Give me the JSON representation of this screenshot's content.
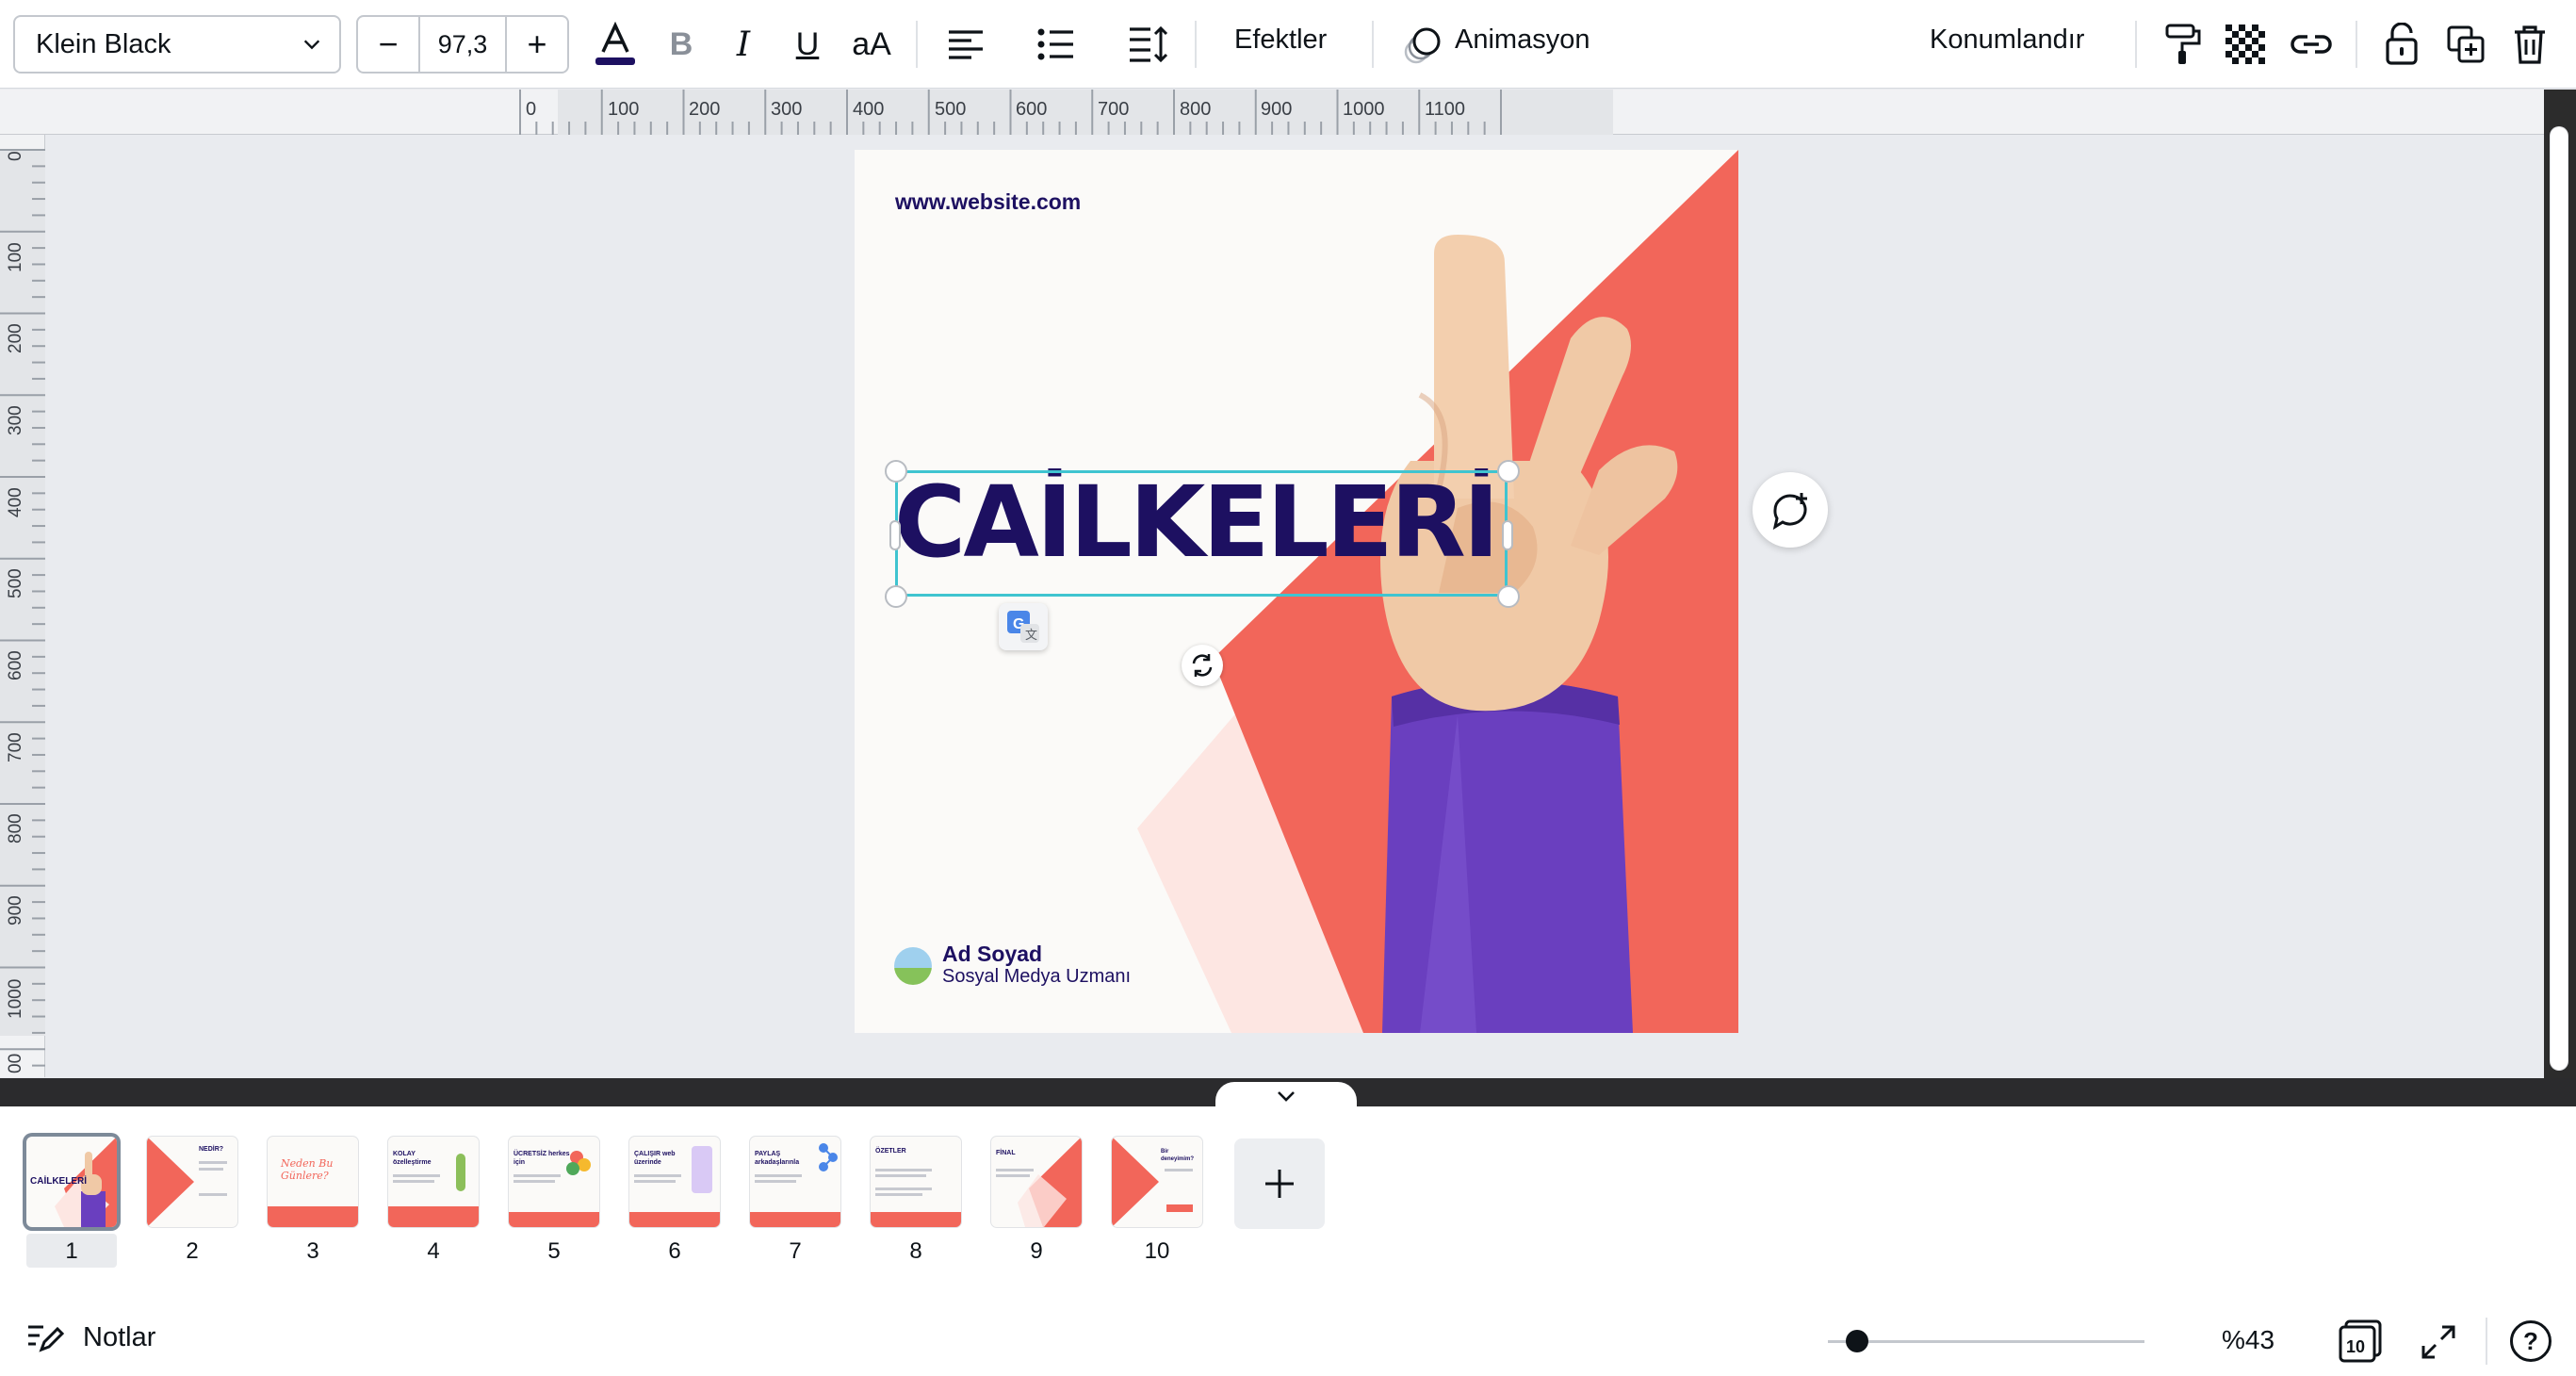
{
  "toolbar": {
    "font_family": "Klein Black",
    "font_size": "97,3",
    "minus_label": "−",
    "plus_label": "+",
    "case_label": "aA",
    "bold_label": "B",
    "italic_label": "I",
    "underline_label": "U",
    "text_color": "#1d1061",
    "effects_label": "Efektler",
    "animation_label": "Animasyon",
    "position_label": "Konumlandır"
  },
  "ruler": {
    "h_ticks": [
      "0",
      "100",
      "200",
      "300",
      "400",
      "500",
      "600",
      "700",
      "800",
      "900",
      "1000",
      "1100"
    ],
    "v_ticks": [
      "0",
      "100",
      "200",
      "300",
      "400",
      "500",
      "600",
      "700",
      "800",
      "900",
      "1000",
      "00"
    ]
  },
  "design": {
    "website": "www.website.com",
    "headline": "CAİLKELERİ",
    "author_name": "Ad Soyad",
    "author_title": "Sosyal Medya Uzmanı",
    "colors": {
      "navy": "#1d1061",
      "coral": "#f2665a",
      "pale_coral": "#fde6e2",
      "purple": "#6a3fbf",
      "selection": "#3fc4d0"
    }
  },
  "pages": [
    {
      "num": "1",
      "title": "CAİLKELERİ"
    },
    {
      "num": "2",
      "title": "NEDİR?"
    },
    {
      "num": "3",
      "title": "Neden Bu Günlere?"
    },
    {
      "num": "4",
      "title": "KOLAY özelleştirme"
    },
    {
      "num": "5",
      "title": "ÜCRETSİZ herkes için"
    },
    {
      "num": "6",
      "title": "ÇALIŞIR web üzerinde"
    },
    {
      "num": "7",
      "title": "PAYLAŞ arkadaşlarınla"
    },
    {
      "num": "8",
      "title": "ÖZETLER"
    },
    {
      "num": "9",
      "title": "FİNAL"
    },
    {
      "num": "10",
      "title": "Bir deneyimim?"
    }
  ],
  "footer": {
    "notes_label": "Notlar",
    "zoom": "%43",
    "zoom_fraction": 0.43,
    "page_count": "10",
    "help_label": "?"
  }
}
